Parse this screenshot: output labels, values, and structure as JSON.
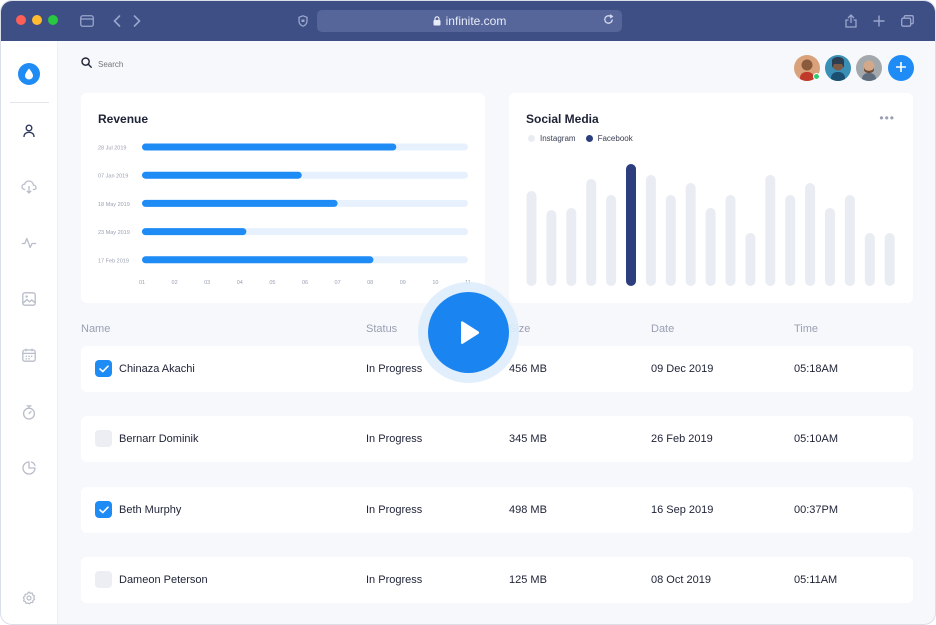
{
  "browser": {
    "url": "infinite.com",
    "traffic_lights": [
      "#fe5f57",
      "#febc2e",
      "#28c840"
    ]
  },
  "search": {
    "placeholder": "Search"
  },
  "revenue": {
    "title": "Revenue",
    "chart_data": {
      "type": "bar",
      "orientation": "horizontal",
      "categories": [
        "28 Jul 2019",
        "07 Jan 2019",
        "18 May 2019",
        "23 May 2019",
        "17 Feb 2019"
      ],
      "values": [
        8.8,
        5.9,
        7.0,
        4.2,
        8.1
      ],
      "xlim": [
        1,
        11
      ],
      "x_ticks": [
        "01",
        "02",
        "03",
        "04",
        "05",
        "06",
        "07",
        "08",
        "09",
        "10",
        "11"
      ],
      "bar_color": "#1f8bf5",
      "track_color": "#e7f1fd"
    }
  },
  "social": {
    "title": "Social Media",
    "chart_data": {
      "type": "bar",
      "series": [
        {
          "name": "Instagram",
          "color": "#e9ecf2"
        },
        {
          "name": "Facebook",
          "color": "#2c3e7e"
        }
      ],
      "values": [
        95,
        76,
        78,
        107,
        91,
        122,
        111,
        91,
        103,
        78,
        91,
        53,
        111,
        91,
        103,
        78,
        91,
        53,
        53
      ],
      "highlight_index": 5,
      "ylim": [
        0,
        122
      ]
    }
  },
  "table": {
    "headers": [
      "Name",
      "Status",
      "Size",
      "Date",
      "Time"
    ],
    "rows": [
      {
        "checked": true,
        "name": "Chinaza Akachi",
        "status": "In Progress",
        "size": "456 MB",
        "date": "09 Dec 2019",
        "time": "05:18AM"
      },
      {
        "checked": false,
        "name": "Bernarr Dominik",
        "status": "In Progress",
        "size": "345 MB",
        "date": "26 Feb 2019",
        "time": "05:10AM"
      },
      {
        "checked": true,
        "name": "Beth Murphy",
        "status": "In Progress",
        "size": "498 MB",
        "date": "16 Sep 2019",
        "time": "00:37PM"
      },
      {
        "checked": false,
        "name": "Dameon Peterson",
        "status": "In Progress",
        "size": "125 MB",
        "date": "08 Oct 2019",
        "time": "05:11AM"
      }
    ]
  },
  "colors": {
    "accent": "#1f8bf5",
    "titlebar": "#3e4f86",
    "online": "#2ecc71"
  },
  "icons": [
    "drop-icon",
    "user-icon",
    "cloud-download-icon",
    "activity-icon",
    "image-icon",
    "calendar-icon",
    "timer-icon",
    "pie-chart-icon",
    "settings-icon",
    "search-icon",
    "plus-icon",
    "play-icon"
  ]
}
